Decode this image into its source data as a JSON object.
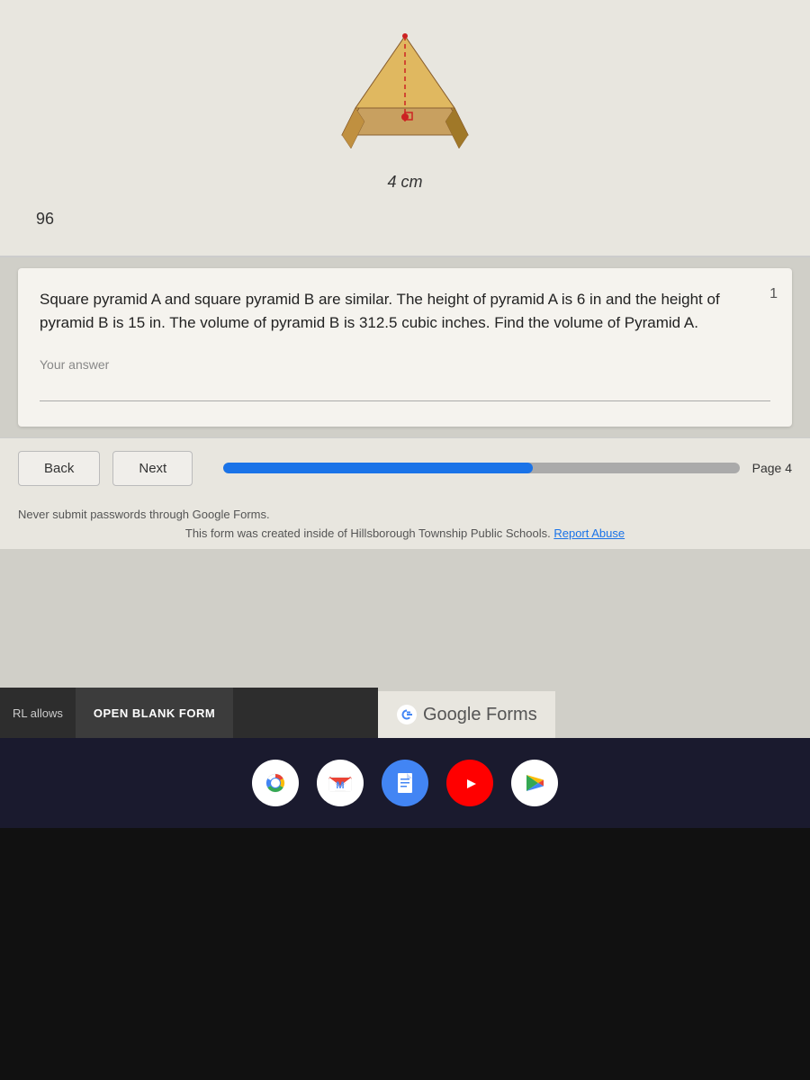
{
  "pyramid": {
    "dimension_label": "4 cm",
    "previous_answer": "96"
  },
  "question": {
    "number": "1",
    "text": "Square pyramid A and square pyramid B are similar. The height of pyramid A is 6 in and the height of pyramid B is 15 in. The volume of pyramid B is 312.5 cubic inches. Find the volume of Pyramid A.",
    "answer_placeholder": "Your answer"
  },
  "navigation": {
    "back_label": "Back",
    "next_label": "Next",
    "progress_percent": 60,
    "page_label": "Page 4"
  },
  "footer": {
    "password_warning": "Never submit passwords through Google Forms.",
    "form_credit": "This form was created inside of Hillsborough Township Public Schools.",
    "report_abuse_label": "Report Abuse"
  },
  "bottom_bar": {
    "rl_text": "RL allows",
    "open_blank_label": "OPEN BLANK FORM",
    "google_forms_label": "Google Forms"
  },
  "taskbar": {
    "icons": [
      {
        "name": "chrome-icon",
        "label": "Chrome"
      },
      {
        "name": "gmail-icon",
        "label": "Gmail"
      },
      {
        "name": "docs-icon",
        "label": "Google Docs"
      },
      {
        "name": "youtube-icon",
        "label": "YouTube"
      },
      {
        "name": "play-store-icon",
        "label": "Play Store"
      }
    ]
  }
}
